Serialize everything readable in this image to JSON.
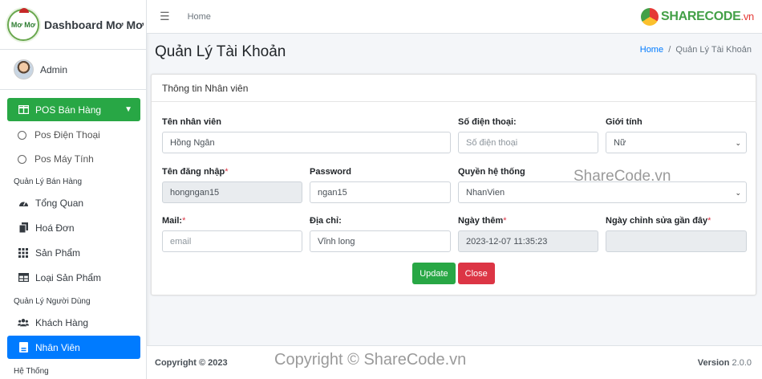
{
  "brand": {
    "title": "Dashboard Mơ Mơ",
    "logo_text": "Mơ Mơ"
  },
  "user": {
    "name": "Admin"
  },
  "sidebar": {
    "pos_group": {
      "label": "POS Bán Hàng",
      "items": [
        "Pos Điện Thoại",
        "Pos Máy Tính"
      ]
    },
    "header_sales": "Quản Lý Bán Hàng",
    "sales_items": [
      "Tổng Quan",
      "Hoá Đơn",
      "Sản Phẩm",
      "Loại Sản Phẩm"
    ],
    "header_users": "Quản Lý Người Dùng",
    "user_items": [
      "Khách Hàng",
      "Nhân Viên"
    ],
    "header_system": "Hệ Thống"
  },
  "topbar": {
    "home": "Home",
    "logo": {
      "main": "SHARECODE",
      "suffix": ".vn"
    }
  },
  "page": {
    "title": "Quản Lý Tài Khoản",
    "breadcrumb": {
      "home": "Home",
      "separator": "/",
      "current": "Quản Lý Tài Khoản"
    }
  },
  "card": {
    "header": "Thông tin Nhân viên"
  },
  "form": {
    "ten_nv": {
      "label": "Tên nhân viên",
      "value": "Hồng Ngân"
    },
    "sdt": {
      "label": "Số điện thoại:",
      "placeholder": "Số điện thoại"
    },
    "gioi_tinh": {
      "label": "Giới tính",
      "value": "Nữ"
    },
    "ten_dn": {
      "label": "Tên đăng nhập",
      "value": "hongngan15"
    },
    "password": {
      "label": "Password",
      "value": "ngan15"
    },
    "quyen": {
      "label": "Quyền hệ thống",
      "value": "NhanVien"
    },
    "mail": {
      "label": "Mail:",
      "placeholder": "email"
    },
    "dia_chi": {
      "label": "Địa chỉ:",
      "value": "Vĩnh long"
    },
    "ngay_them": {
      "label": "Ngày thêm",
      "value": "2023-12-07 11:35:23"
    },
    "ngay_sua": {
      "label": "Ngày chỉnh sửa gần đây",
      "value": ""
    },
    "required_mark": "*"
  },
  "buttons": {
    "update": "Update",
    "close": "Close"
  },
  "footer": {
    "copyright": "Copyright © 2023",
    "version_label": "Version",
    "version": "2.0.0"
  },
  "watermarks": {
    "middle": "ShareCode.vn",
    "bottom": "Copyright © ShareCode.vn"
  },
  "colors": {
    "green": "#28a745",
    "blue": "#007bff",
    "red": "#dc3545"
  }
}
